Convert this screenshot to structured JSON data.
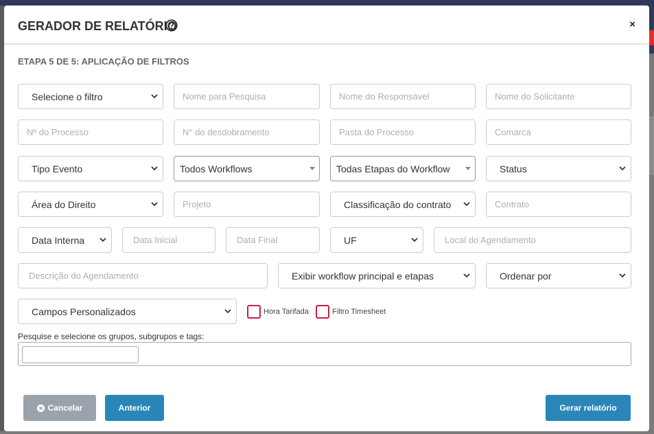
{
  "modal": {
    "title": "GERADOR DE RELATÓRIO",
    "step": "ETAPA 5 DE 5: APLICAÇÃO DE FILTROS",
    "close_label": "×"
  },
  "fields": {
    "select_filter": "Selecione o filtro",
    "search_name": "Nome para Pesquisa",
    "responsible_name": "Nome do Responsável",
    "requester_name": "Nome do Solicitante",
    "process_number": "Nº do Processo",
    "split_number": "N° do desdobramento",
    "process_folder": "Pasta do Processo",
    "district": "Comarca",
    "event_type": "Tipo Evento",
    "all_workflows": "Todos Workflows",
    "all_workflow_steps": "Todas Etapas do Workflow",
    "status": "Status",
    "law_area": "Área do Direito",
    "project": "Projeto",
    "contract_classification": "Classificação do contrato",
    "contract": "Contrato",
    "internal_date": "Data Interna",
    "start_date": "Data Inicial",
    "end_date": "Data Final",
    "uf": "UF",
    "schedule_location": "Local do Agendamento",
    "schedule_description": "Descrição do Agendamento",
    "show_workflow": "Exibir workflow principal e etapas",
    "order_by": "Ordenar por",
    "custom_fields": "Campos Personalizados"
  },
  "checkboxes": {
    "billed_hours": "Hora Tarifada",
    "timesheet_filter": "Filtro Timesheet"
  },
  "tags": {
    "label": "Pesquise e selecione os grupos, subgrupos e tags:",
    "value": ""
  },
  "buttons": {
    "cancel": "Cancelar",
    "previous": "Anterior",
    "generate": "Gerar relatório"
  },
  "colors": {
    "primary": "#2a86b9",
    "cancel": "#9aa3ab",
    "checkbox_border": "#c8203f"
  },
  "icons": {
    "help": "question-circle-icon",
    "close": "close-icon",
    "cancel": "x-circle-icon"
  }
}
